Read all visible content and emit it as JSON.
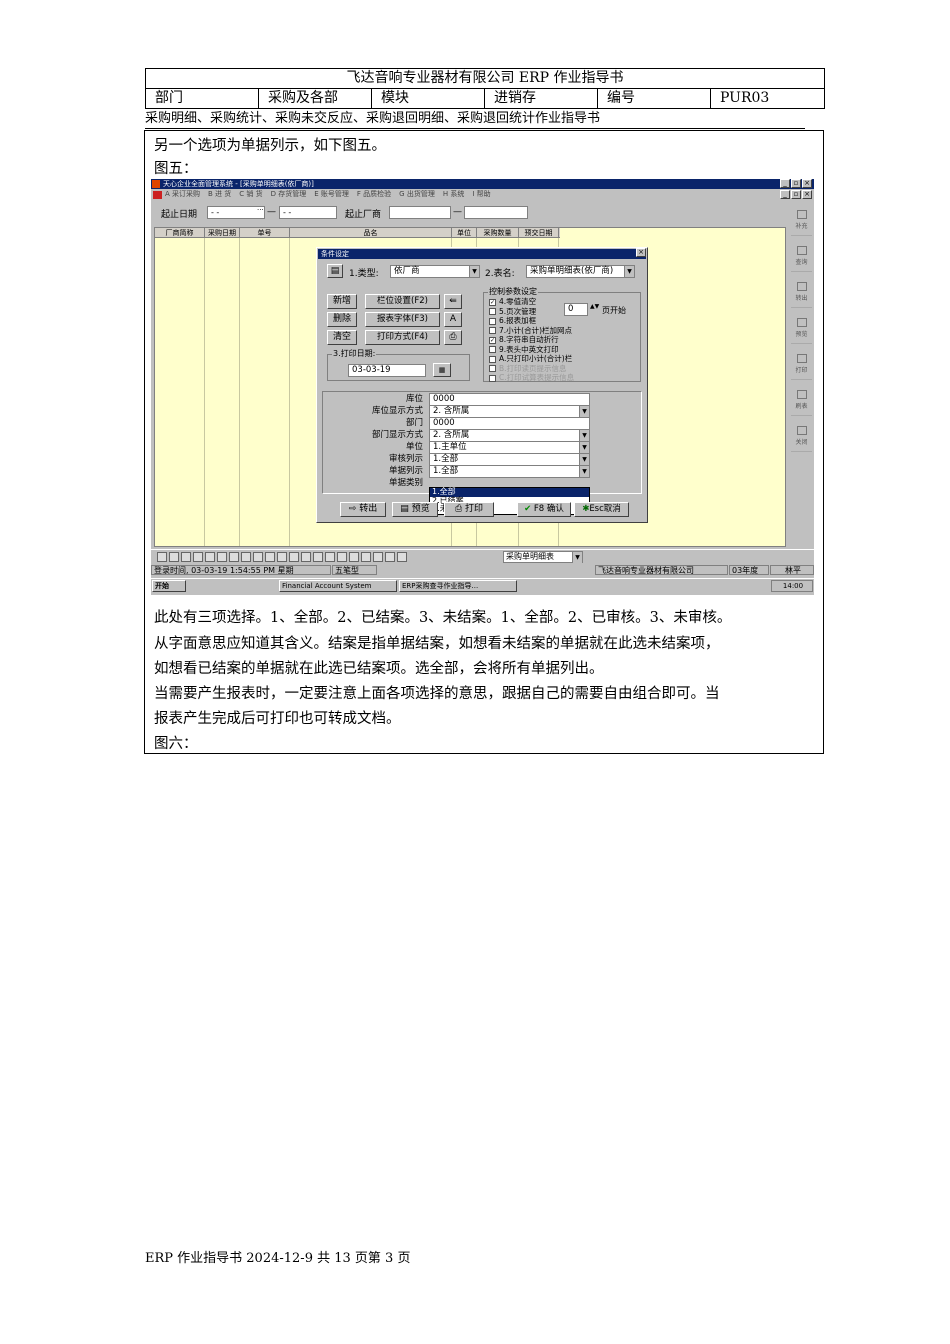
{
  "header": {
    "title": "飞达音响专业器材有限公司 ERP 作业指导书",
    "dept_label": "部门",
    "dept_value": "采购及各部",
    "module_label": "模块",
    "module_value": "进销存",
    "code_label": "编号",
    "code_value": "PUR03"
  },
  "subtitle": "采购明细、采购统计、采购未交反应、采购退回明细、采购退回统计作业指导书",
  "body": {
    "p1": "另一个选项为单据列示，如下图五。",
    "fig5": "图五：",
    "p2_line1": "此处有三项选择。1、全部。2、已结案。3、未结案。1、全部。2、已审核。3、未审核。",
    "p2_line2": "从字面意思应知道其含义。结案是指单据结案，如想看未结案的单据就在此选未结案项，",
    "p2_line3": "如想看已结案的单据就在此选已结案项。选全部，会将所有单据列出。",
    "p3_line1": "当需要产生报表时，一定要注意上面各项选择的意思，跟据自己的需要自由组合即可。当",
    "p3_line2": "报表产生完成后可打印也可转成文档。",
    "fig6": "图六："
  },
  "screenshot": {
    "window_title": "天心企业全面管理系统 - [采购单明细表(依厂商)]",
    "menus": [
      "A 采订采购",
      "B 进 货",
      "C 销 货",
      "D 存货管理",
      "E 账号管理",
      "F 品质检验",
      "G 出货管理",
      "H 系统",
      "I 帮助"
    ],
    "filter": {
      "date_label": "起止日期",
      "date_from": "- -",
      "date_to": "- -",
      "vendor_label": "起止厂商"
    },
    "grid_headers": [
      "厂商简称",
      "采购日期",
      "单号",
      "品名",
      "单位",
      "采购数量",
      "预交日期"
    ],
    "right_tools": [
      "补充",
      "查询",
      "转出",
      "预览",
      "打印",
      "刷表",
      "关闭"
    ],
    "bottom_select": "采购单明细表",
    "status": {
      "login": "登录时间, 03-03-19 1:54:55 PM 星期",
      "ime": "五笔型",
      "company": "飞达音响专业器材有限公司",
      "year": "03年度",
      "user": "林平"
    },
    "taskbar": {
      "start": "开始",
      "task1": "Financial Account System",
      "task2": "ERP采购查寻作业指导...",
      "clock": "14:00"
    },
    "dialog": {
      "title": "条件设定",
      "type_label": "1.类型:",
      "type_value": "依厂商",
      "table_label": "2.表名:",
      "table_value": "采购单明细表(依厂商)",
      "btn_new": "新增",
      "btn_delete": "删除",
      "btn_clear": "清空",
      "btn_column": "栏位设置(F2)",
      "btn_font": "报表字体(F3)",
      "btn_print_mode": "打印方式(F4)",
      "print_date_label": "3.打印日期:",
      "print_date_value": "03-03-19",
      "control_label": "控制参数设定",
      "checks": [
        {
          "label": "4.零值清空",
          "checked": true,
          "disabled": false
        },
        {
          "label": "5.页次管理",
          "checked": false,
          "disabled": false
        },
        {
          "label": "6.报表加框",
          "checked": false,
          "disabled": false
        },
        {
          "label": "7.小计(合计)栏加网点",
          "checked": false,
          "disabled": false
        },
        {
          "label": "8.字符串自动折行",
          "checked": true,
          "disabled": false
        },
        {
          "label": "9.表头中英文打印",
          "checked": false,
          "disabled": false
        },
        {
          "label": "A.只打印小计(合计)栏",
          "checked": false,
          "disabled": false
        },
        {
          "label": "B.打印读页提示信息",
          "checked": false,
          "disabled": true
        },
        {
          "label": "C.打印试算表提示信息",
          "checked": false,
          "disabled": true
        }
      ],
      "page_start_value": "0",
      "page_start_label": "页开始",
      "fields": [
        {
          "label": "库位",
          "value": "0000",
          "dropdown": false
        },
        {
          "label": "库位显示方式",
          "value": "2. 含所属",
          "dropdown": true
        },
        {
          "label": "部门",
          "value": "0000",
          "dropdown": false
        },
        {
          "label": "部门显示方式",
          "value": "2. 含所属",
          "dropdown": true
        },
        {
          "label": "单位",
          "value": "1.主单位",
          "dropdown": true
        },
        {
          "label": "审核列示",
          "value": "1.全部",
          "dropdown": true
        },
        {
          "label": "单据列示",
          "value": "1.全部",
          "dropdown": true
        },
        {
          "label": "单据类别",
          "value": "",
          "dropdown": false
        }
      ],
      "dropdown_options": [
        "1.全部",
        "2.已结案",
        "3.未结案"
      ],
      "btn_export": "转出",
      "btn_preview": "预览",
      "btn_print": "打印",
      "btn_ok": "F8 确认",
      "btn_cancel": "Esc取消"
    }
  },
  "footer": "ERP 作业指导书 2024-12-9 共 13 页第 3 页"
}
